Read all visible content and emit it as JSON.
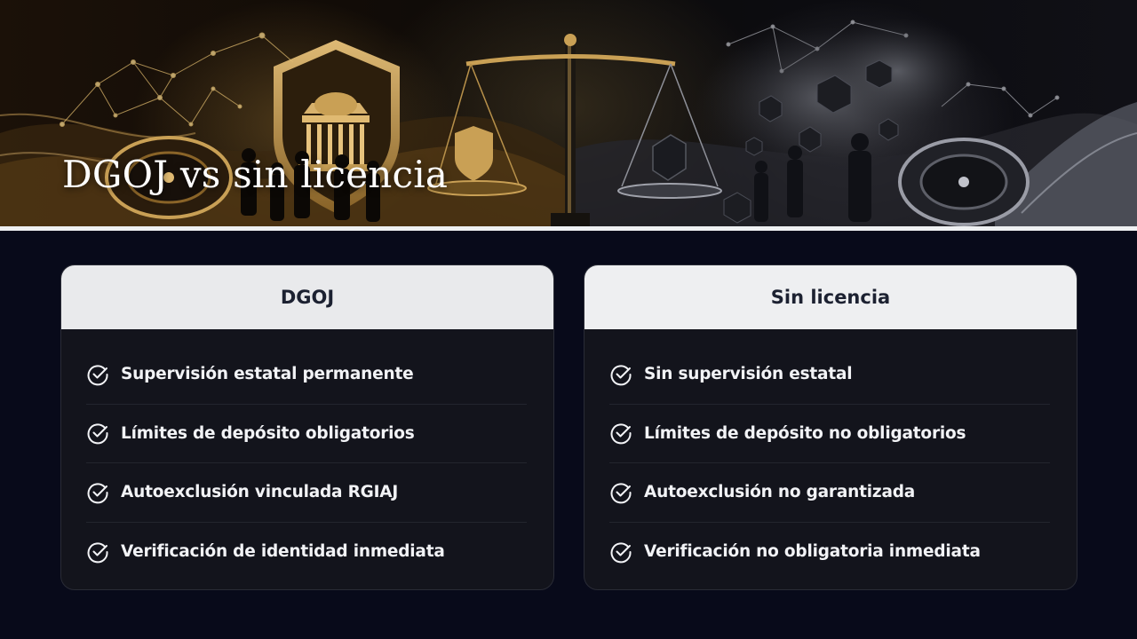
{
  "hero": {
    "title": "DGOJ vs sin licencia"
  },
  "comparison": {
    "left": {
      "header": "DGOJ",
      "items": [
        "Supervisión estatal permanente",
        "Límites de depósito obligatorios",
        "Autoexclusión vinculada RGIAJ",
        "Verificación de identidad inmediata"
      ]
    },
    "right": {
      "header": "Sin licencia",
      "items": [
        "Sin supervisión estatal",
        "Límites de depósito no obligatorios",
        "Autoexclusión no garantizada",
        "Verificación no obligatoria inmediata"
      ]
    }
  },
  "icons": {
    "check": "check-circle-icon"
  },
  "colors": {
    "background": "#080a1a",
    "card": "#13141c",
    "card_header": "#e9eaec",
    "text": "#f2f3f6",
    "gold_accent": "#c9a055"
  }
}
